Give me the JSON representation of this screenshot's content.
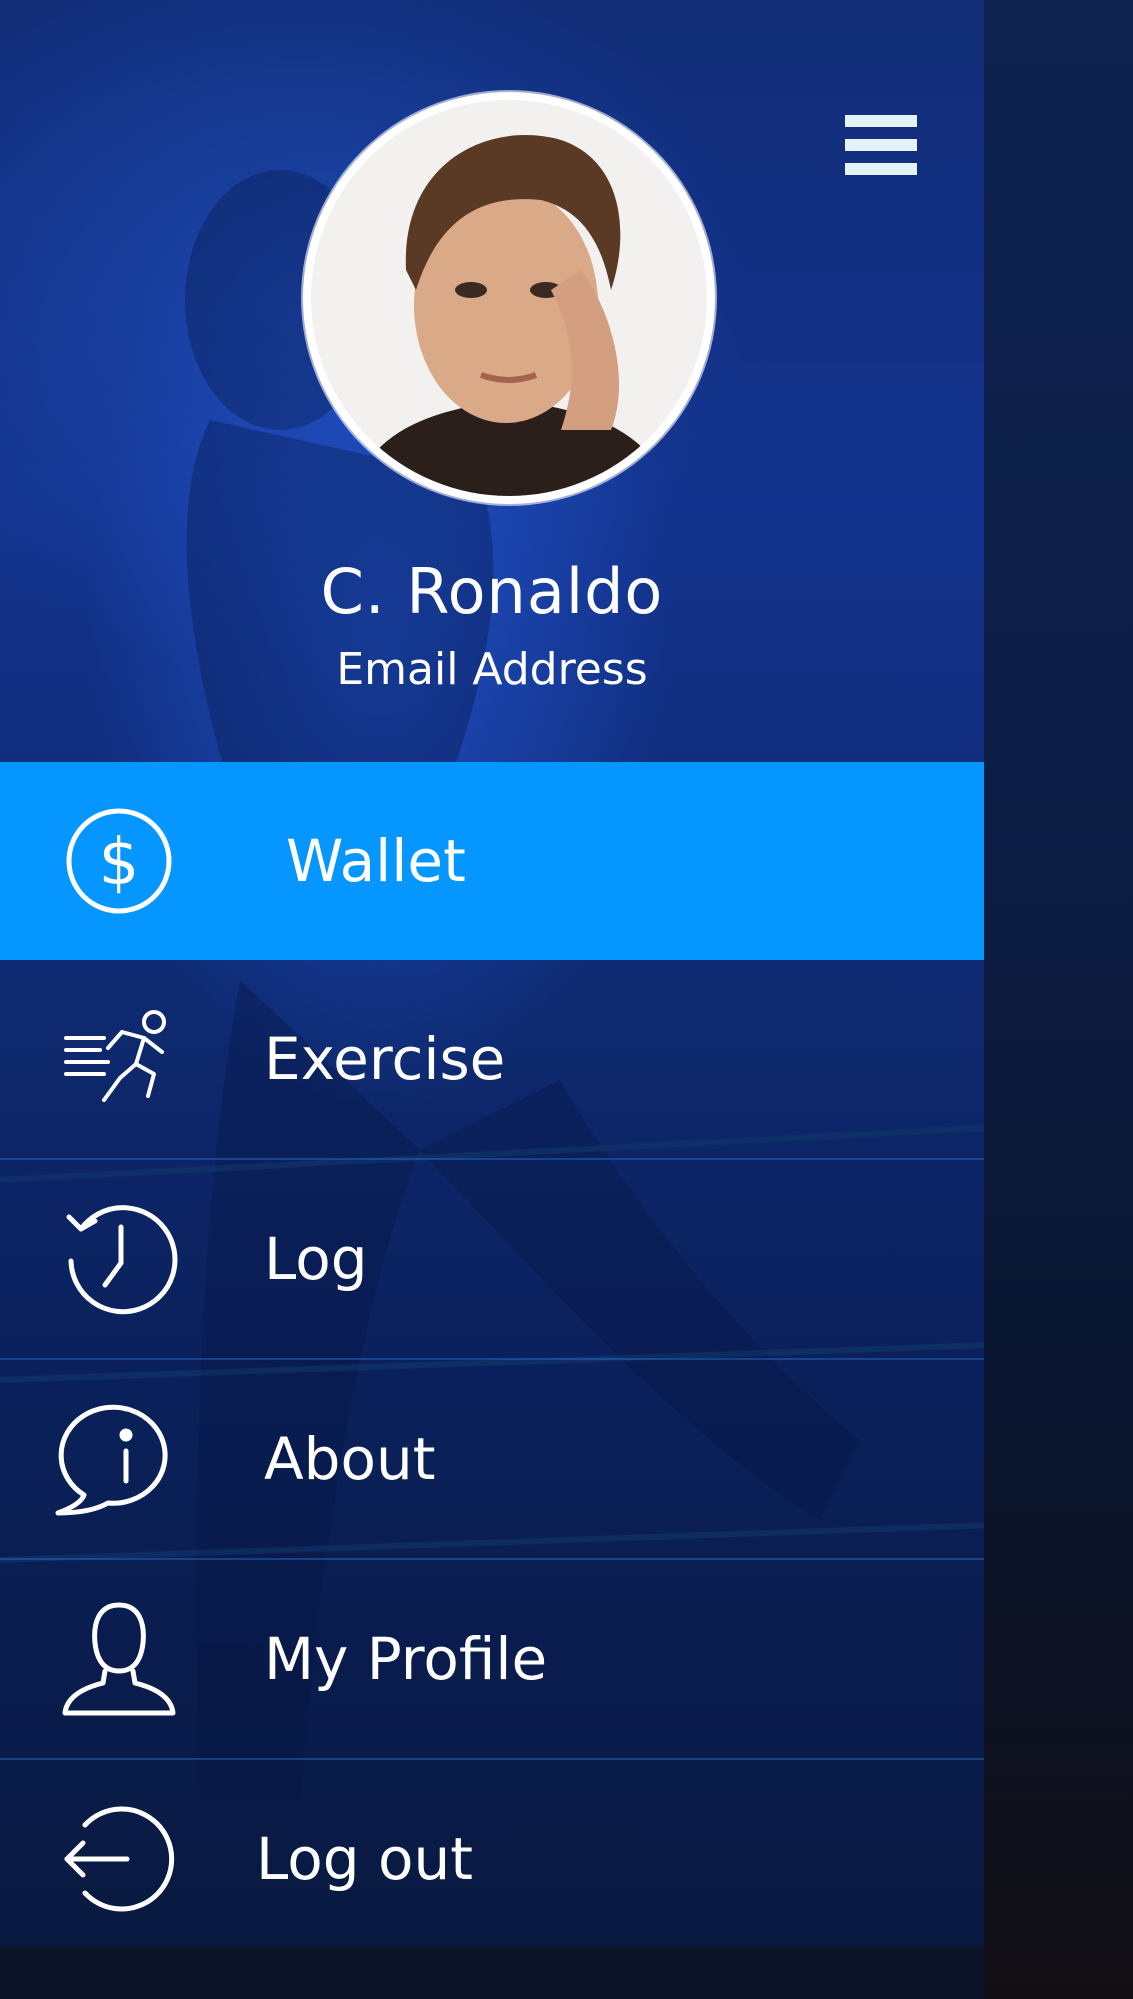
{
  "profile": {
    "name": "C. Ronaldo",
    "email": "Email Address"
  },
  "menu": {
    "items": [
      {
        "label": "Wallet",
        "icon": "dollar-circle-icon",
        "active": true
      },
      {
        "label": "Exercise",
        "icon": "running-man-icon",
        "active": false
      },
      {
        "label": "Log",
        "icon": "history-clock-icon",
        "active": false
      },
      {
        "label": "About",
        "icon": "info-speech-bubble-icon",
        "active": false
      },
      {
        "label": "My Profile",
        "icon": "user-outline-icon",
        "active": false
      },
      {
        "label": "Log out",
        "icon": "logout-arrow-circle-icon",
        "active": false
      }
    ]
  },
  "colors": {
    "active_item": "#0597ff",
    "text": "#ffffff",
    "hamburger": "#e3f3f8"
  }
}
